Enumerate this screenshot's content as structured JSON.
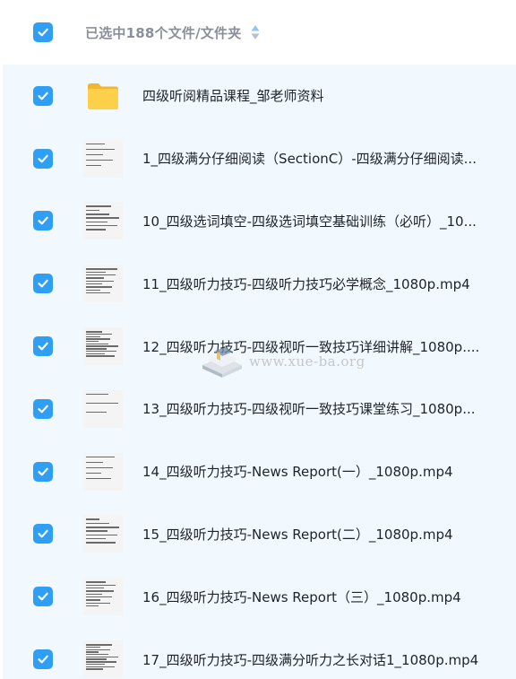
{
  "header": {
    "title": "已选中188个文件/文件夹",
    "sort_icon": "sort-toggle-icon"
  },
  "colors": {
    "checkbox": "#2f9ef5",
    "list_background": "#f1f8fe",
    "header_text": "#8a8f99",
    "folder": "#f7c234"
  },
  "files": [
    {
      "name": "四级听阅精品课程_邹老师资料",
      "type": "folder",
      "checked": true
    },
    {
      "name": "1_四级满分仔细阅读（SectionC）-四级满分仔细阅读...",
      "type": "video",
      "checked": true
    },
    {
      "name": "10_四级选词填空-四级选词填空基础训练（必听）_10...",
      "type": "video",
      "checked": true
    },
    {
      "name": "11_四级听力技巧-四级听力技巧必学概念_1080p.mp4",
      "type": "video",
      "checked": true
    },
    {
      "name": "12_四级听力技巧-四级视听一致技巧详细讲解_1080p....",
      "type": "video",
      "checked": true
    },
    {
      "name": "13_四级听力技巧-四级视听一致技巧课堂练习_1080p...",
      "type": "video",
      "checked": true
    },
    {
      "name": "14_四级听力技巧-News Report(一）_1080p.mp4",
      "type": "video",
      "checked": true
    },
    {
      "name": "15_四级听力技巧-News Report(二）_1080p.mp4",
      "type": "video",
      "checked": true
    },
    {
      "name": "16_四级听力技巧-News Report（三）_1080p.mp4",
      "type": "video",
      "checked": true
    },
    {
      "name": "17_四级听力技巧-四级满分听力之长对话1_1080p.mp4",
      "type": "video",
      "checked": true
    }
  ],
  "watermark": {
    "text": "www.xue-ba.org"
  }
}
